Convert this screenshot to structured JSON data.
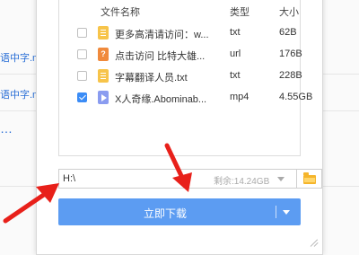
{
  "background": {
    "links": [
      "语中字.m",
      "语中字.mp",
      "…"
    ]
  },
  "file_list": {
    "headers": {
      "name": "文件名称",
      "type": "类型",
      "size": "大小"
    },
    "rows": [
      {
        "checked": false,
        "icon": "txt-file-icon",
        "name": "更多高清请访问：w...",
        "type": "txt",
        "size": "62B"
      },
      {
        "checked": false,
        "icon": "url-file-icon",
        "name": "点击访问 比特大雄...",
        "type": "url",
        "size": "176B"
      },
      {
        "checked": false,
        "icon": "txt-file-icon",
        "name": "字幕翻译人员.txt",
        "type": "txt",
        "size": "228B"
      },
      {
        "checked": true,
        "icon": "video-file-icon",
        "name": "X人奇缘.Abominab...",
        "type": "mp4",
        "size": "4.55GB"
      }
    ]
  },
  "save_path": {
    "value": "H:\\",
    "free_space": "剩余:14.24GB"
  },
  "download_button": {
    "label": "立即下载"
  },
  "colors": {
    "accent": "#5c9cf2",
    "checkbox_checked": "#3b8cf6",
    "folder": "#f5b52b",
    "annotation_arrow": "#e8201a"
  }
}
